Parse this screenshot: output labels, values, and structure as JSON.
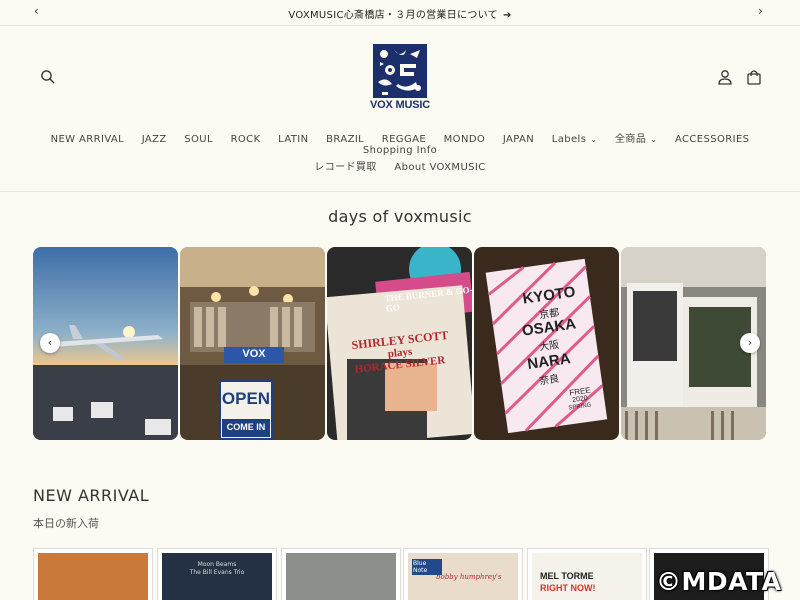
{
  "announcement": {
    "text": "VOXMUSIC心斎橋店・３月の営業日について",
    "arrow_glyph": "➔"
  },
  "header": {
    "logo_text": "VOX MUSIC",
    "brand_color": "#1b2f6b"
  },
  "nav": {
    "row1": [
      {
        "label": "NEW ARRIVAL"
      },
      {
        "label": "JAZZ"
      },
      {
        "label": "SOUL"
      },
      {
        "label": "ROCK"
      },
      {
        "label": "LATIN"
      },
      {
        "label": "BRAZIL"
      },
      {
        "label": "REGGAE"
      },
      {
        "label": "MONDO"
      },
      {
        "label": "JAPAN"
      },
      {
        "label": "Labels",
        "dropdown": true
      },
      {
        "label": "全商品",
        "dropdown": true
      },
      {
        "label": "ACCESSORIES"
      },
      {
        "label": "Shopping Info"
      }
    ],
    "row2": [
      {
        "label": "レコード買取"
      },
      {
        "label": "About VOXMUSIC"
      }
    ]
  },
  "days": {
    "title": "days of voxmusic",
    "tiles": [
      {
        "subject": "airplane at sunset"
      },
      {
        "subject": "record shop interior",
        "text": "OPEN",
        "text2": "COME IN",
        "sign": "VOX"
      },
      {
        "subject": "record covers",
        "text": "SHIRLEY SCOTT",
        "text2": "plays",
        "text3": "HORACE SILVER",
        "text4": "THE BURNER & GO-GO"
      },
      {
        "subject": "poster",
        "text": "KYOTO",
        "text2": "京都",
        "text3": "OSAKA",
        "text4": "大阪",
        "text5": "NARA",
        "text6": "奈良",
        "text7": "FREE",
        "text8": "2020",
        "text9": "SPRING"
      },
      {
        "subject": "record covers in bins"
      }
    ]
  },
  "new_arrival": {
    "title": "NEW ARRIVAL",
    "subtitle": "本日の新入荷",
    "cards": [
      {
        "caption": ""
      },
      {
        "caption": "Moon Beams",
        "caption2": "The Bill Evans Trio"
      },
      {
        "caption": ""
      },
      {
        "caption": "Blue Note",
        "caption2": "bobby humphrey's"
      },
      {
        "caption": "MEL TORME",
        "caption2": "RIGHT NOW!"
      },
      {
        "caption": ""
      }
    ]
  },
  "watermark": "©MDATA"
}
